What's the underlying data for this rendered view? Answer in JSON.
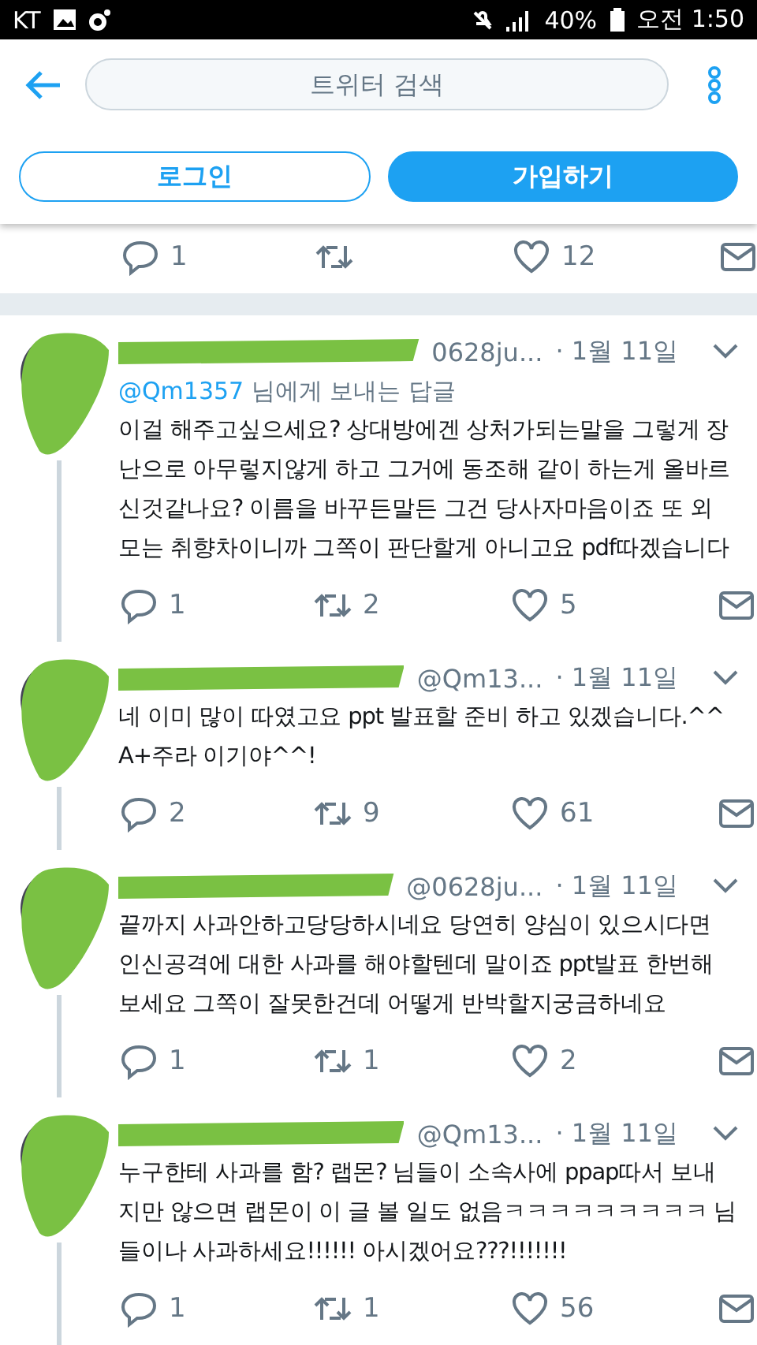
{
  "status_bar": {
    "carrier": "KT",
    "battery": "40%",
    "time": "오전 1:50"
  },
  "header": {
    "search": {
      "placeholder": "트위터 검색"
    },
    "login": "로그인",
    "signup": "가입하기"
  },
  "previous_tweet_actions": {
    "replies": "1",
    "likes": "12"
  },
  "tweets": [
    {
      "handle": "0628ju...",
      "date": "· 1월 11일",
      "reply_to": {
        "handle": "@Qm1357",
        "text": "님에게 보내는 답글"
      },
      "body_lines": [
        "이걸 해주고싶으세요? 상대방에겐 상처가되는말을 그렇게 장",
        "난으로 아무렇지않게 하고 그거에 동조해 같이 하는게 올바르",
        "신것같나요? 이름을 바꾸든말든 그건 당사자마음이죠 또 외",
        "모는 취향차이니까 그쪽이 판단할게 아니고요 pdf따겠습니다"
      ],
      "replies": "1",
      "retweets": "2",
      "likes": "5"
    },
    {
      "handle": "@Qm13...",
      "date": "· 1월 11일",
      "body_lines": [
        "네 이미 많이 따였고요 ppt 발표할 준비 하고 있겠습니다.^^",
        "A+주라 이기야^^!"
      ],
      "replies": "2",
      "retweets": "9",
      "likes": "61"
    },
    {
      "handle": "@0628ju...",
      "date": "· 1월 11일",
      "body_lines": [
        "끝까지 사과안하고당당하시네요 당연히 양심이 있으시다면",
        "인신공격에 대한 사과를 해야할텐데 말이죠 ppt발표 한번해",
        "보세요 그쪽이 잘못한건데 어떻게 반박할지궁금하네요"
      ],
      "replies": "1",
      "retweets": "1",
      "likes": "2"
    },
    {
      "handle": "@Qm13...",
      "date": "· 1월 11일",
      "body_lines": [
        "누구한테 사과를 함? 랩몬? 님들이 소속사에 ppap따서 보내",
        "지만 않으면 랩몬이 이 글 볼 일도 없음ㅋㅋㅋㅋㅋㅋㅋㅋㅋ 님",
        "들이나 사과하세요!!!!!! 아시겠어요???!!!!!!!"
      ],
      "replies": "1",
      "retweets": "1",
      "likes": "56"
    }
  ]
}
